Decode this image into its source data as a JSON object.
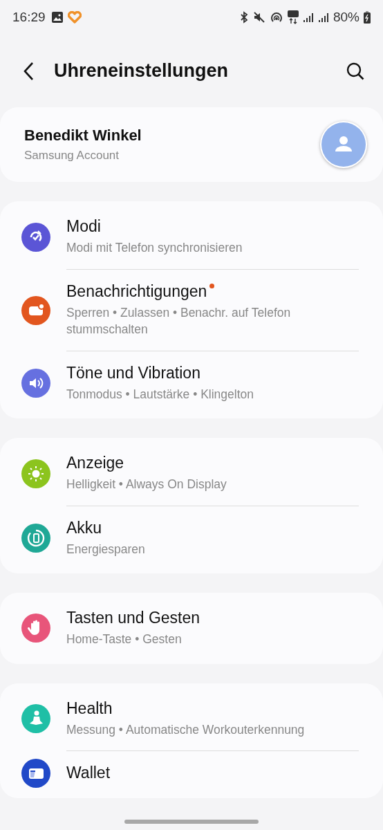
{
  "status_bar": {
    "time": "16:29",
    "battery": "80%"
  },
  "header": {
    "title": "Uhreneinstellungen"
  },
  "account": {
    "name": "Benedikt Winkel",
    "subtitle": "Samsung Account"
  },
  "groups": [
    {
      "items": [
        {
          "title": "Modi",
          "subtitle": "Modi mit Telefon synchronisieren",
          "color": "#5b55d6",
          "badge": false
        },
        {
          "title": "Benachrichtigungen",
          "subtitle": "Sperren • Zulassen • Benachr. auf Telefon stummschalten",
          "color": "#e2561f",
          "badge": true
        },
        {
          "title": "Töne und Vibration",
          "subtitle": "Tonmodus • Lautstärke • Klingelton",
          "color": "#6670e0",
          "badge": false
        }
      ]
    },
    {
      "items": [
        {
          "title": "Anzeige",
          "subtitle": "Helligkeit • Always On Display",
          "color": "#8cc41e",
          "badge": false
        },
        {
          "title": "Akku",
          "subtitle": "Energiesparen",
          "color": "#1fa896",
          "badge": false
        }
      ]
    },
    {
      "items": [
        {
          "title": "Tasten und Gesten",
          "subtitle": "Home-Taste • Gesten",
          "color": "#e8557a",
          "badge": false
        }
      ]
    },
    {
      "items": [
        {
          "title": "Health",
          "subtitle": "Messung • Automatische Workouterkennung",
          "color": "#1fbfa6",
          "badge": false
        },
        {
          "title": "Wallet",
          "color": "#2149c8",
          "badge": false
        }
      ]
    }
  ]
}
